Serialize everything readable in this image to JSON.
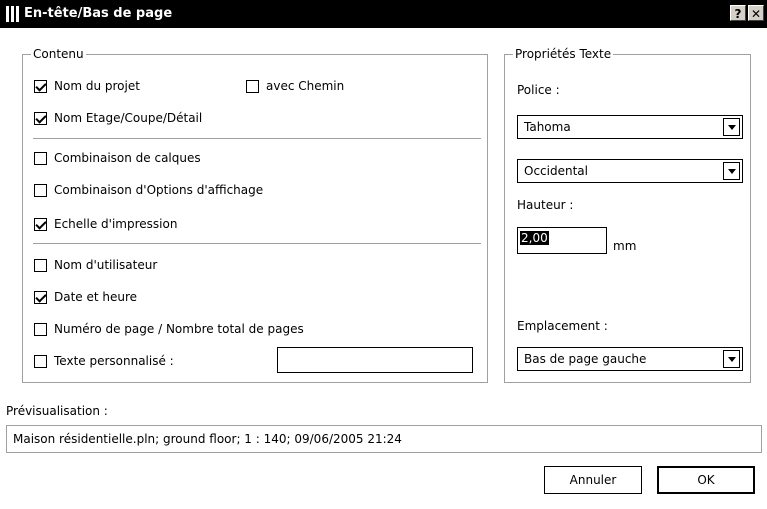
{
  "window": {
    "title": "En-tête/Bas de page",
    "help_label": "?",
    "close_label": "✕"
  },
  "contenu": {
    "title": "Contenu",
    "nom_projet": {
      "label": "Nom du projet",
      "checked": true
    },
    "avec_chemin": {
      "label": "avec Chemin",
      "checked": false
    },
    "nom_etage": {
      "label": "Nom Etage/Coupe/Détail",
      "checked": true
    },
    "combinaison_calques": {
      "label": "Combinaison de calques",
      "checked": false
    },
    "combinaison_options": {
      "label": "Combinaison d'Options d'affichage",
      "checked": false
    },
    "echelle": {
      "label": "Echelle d'impression",
      "checked": true
    },
    "nom_utilisateur": {
      "label": "Nom d'utilisateur",
      "checked": false
    },
    "date_heure": {
      "label": "Date et heure",
      "checked": true
    },
    "numero_page": {
      "label": "Numéro de page / Nombre total de pages",
      "checked": false
    },
    "texte_perso": {
      "label": "Texte personnalisé :",
      "checked": false,
      "value": ""
    }
  },
  "proprietes": {
    "title": "Propriétés Texte",
    "police_label": "Police :",
    "police_value": "Tahoma",
    "script_value": "Occidental",
    "hauteur_label": "Hauteur :",
    "hauteur_value": "2,00",
    "hauteur_unit": "mm",
    "emplacement_label": "Emplacement :",
    "emplacement_value": "Bas de page gauche"
  },
  "preview": {
    "label": "Prévisualisation :",
    "text": "Maison résidentielle.pln; ground floor; 1 : 140; 09/06/2005 21:24"
  },
  "buttons": {
    "cancel": "Annuler",
    "ok": "OK"
  }
}
